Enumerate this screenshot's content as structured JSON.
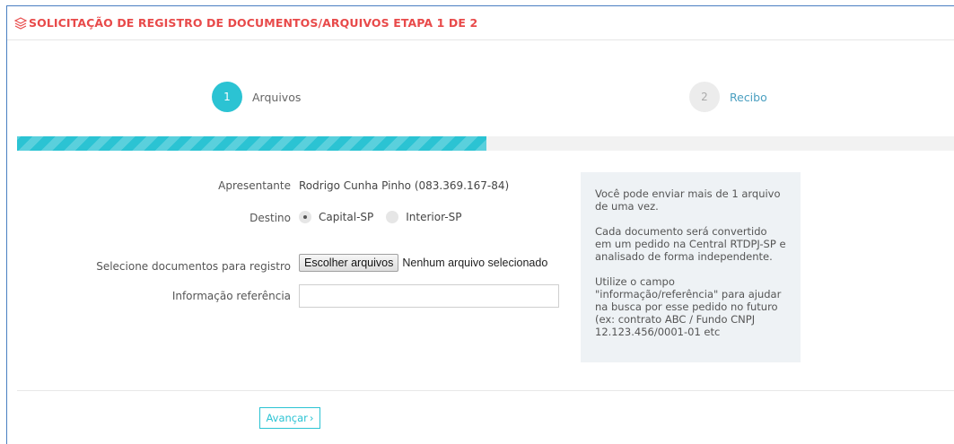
{
  "header": {
    "title": "SOLICITAÇÃO DE REGISTRO DE DOCUMENTOS/ARQUIVOS ETAPA 1 DE 2",
    "icon": "layers-icon"
  },
  "steps": [
    {
      "number": "1",
      "label": "Arquivos",
      "active": true
    },
    {
      "number": "2",
      "label": "Recibo",
      "active": false
    }
  ],
  "progress": {
    "percent": 50,
    "color": "#2bc3d3"
  },
  "form": {
    "apresentante_label": "Apresentante",
    "apresentante_value": "Rodrigo Cunha Pinho (083.369.167-84)",
    "destino_label": "Destino",
    "destino_options": [
      {
        "label": "Capital-SP",
        "checked": true
      },
      {
        "label": "Interior-SP",
        "checked": false
      }
    ],
    "files_label": "Selecione documentos para registro",
    "files_button": "Escolher arquivos",
    "files_status": "Nenhum arquivo selecionado",
    "info_ref_label": "Informação referência",
    "info_ref_value": ""
  },
  "info_box": {
    "paragraphs": [
      "Você pode enviar mais de 1 arquivo de uma vez.",
      "Cada documento será convertido em um pedido na Central RTDPJ-SP e analisado de forma independente.",
      "Utilize o campo \"informação/referência\" para ajudar na busca por esse pedido no futuro (ex: contrato ABC / Fundo CNPJ 12.123.456/0001-01 etc"
    ]
  },
  "footer": {
    "advance_label": "Avançar",
    "advance_icon": "chevron-right-icon"
  },
  "colors": {
    "accent": "#2bc3d3",
    "title": "#e84a4a",
    "frame_border": "#4a7fc1"
  }
}
